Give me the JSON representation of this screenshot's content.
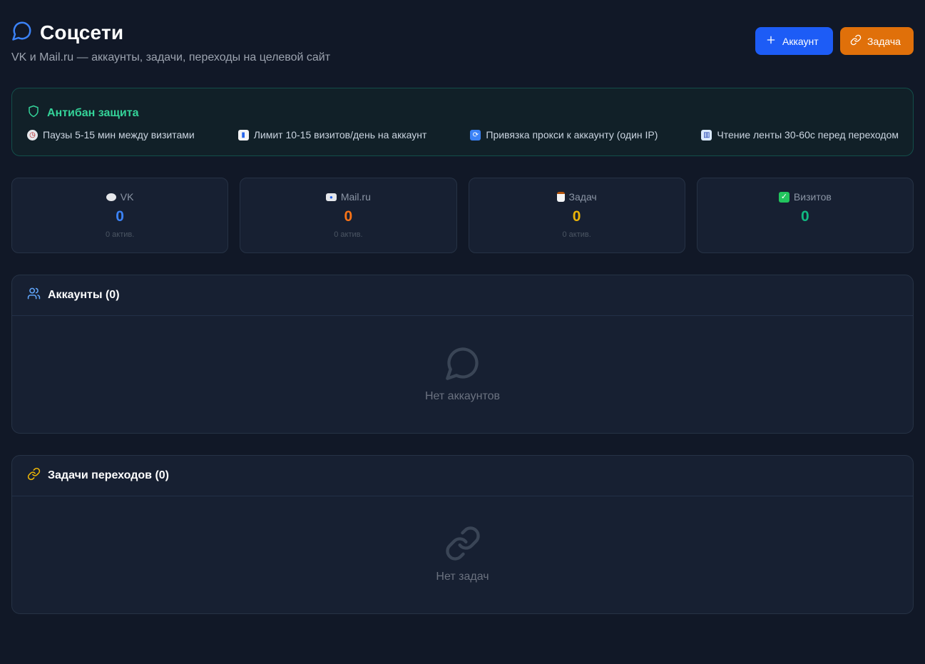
{
  "header": {
    "title": "Соцсети",
    "subtitle": "VK и Mail.ru — аккаунты, задачи, переходы на целевой сайт",
    "add_account_label": "Аккаунт",
    "add_task_label": "Задача"
  },
  "antiban": {
    "title": "Антибан защита",
    "items": [
      {
        "icon": "clock-emoji",
        "text": "Паузы 5-15 мин между визитами"
      },
      {
        "icon": "chart-emoji",
        "text": "Лимит 10-15 визитов/день на аккаунт"
      },
      {
        "icon": "repeat-emoji",
        "text": "Привязка прокси к аккаунту (один IP)"
      },
      {
        "icon": "book-emoji",
        "text": "Чтение ленты 30-60с перед переходом"
      }
    ]
  },
  "stats": [
    {
      "icon": "speech-bubble-emoji",
      "label": "VK",
      "value": "0",
      "sub": "0 актив.",
      "color": "#3b82f6"
    },
    {
      "icon": "envelope-emoji",
      "label": "Mail.ru",
      "value": "0",
      "sub": "0 актив.",
      "color": "#f97316"
    },
    {
      "icon": "clipboard-emoji",
      "label": "Задач",
      "value": "0",
      "sub": "0 актив.",
      "color": "#eab308"
    },
    {
      "icon": "check-mark-emoji",
      "label": "Визитов",
      "value": "0",
      "sub": "",
      "color": "#10b981"
    }
  ],
  "accounts": {
    "title": "Аккаунты (0)",
    "empty_text": "Нет аккаунтов"
  },
  "tasks": {
    "title": "Задачи переходов (0)",
    "empty_text": "Нет задач"
  },
  "colors": {
    "background": "#111827",
    "primary_button": "#1d5cf6",
    "task_button": "#e0700a",
    "antiban_accent": "#34d399"
  }
}
